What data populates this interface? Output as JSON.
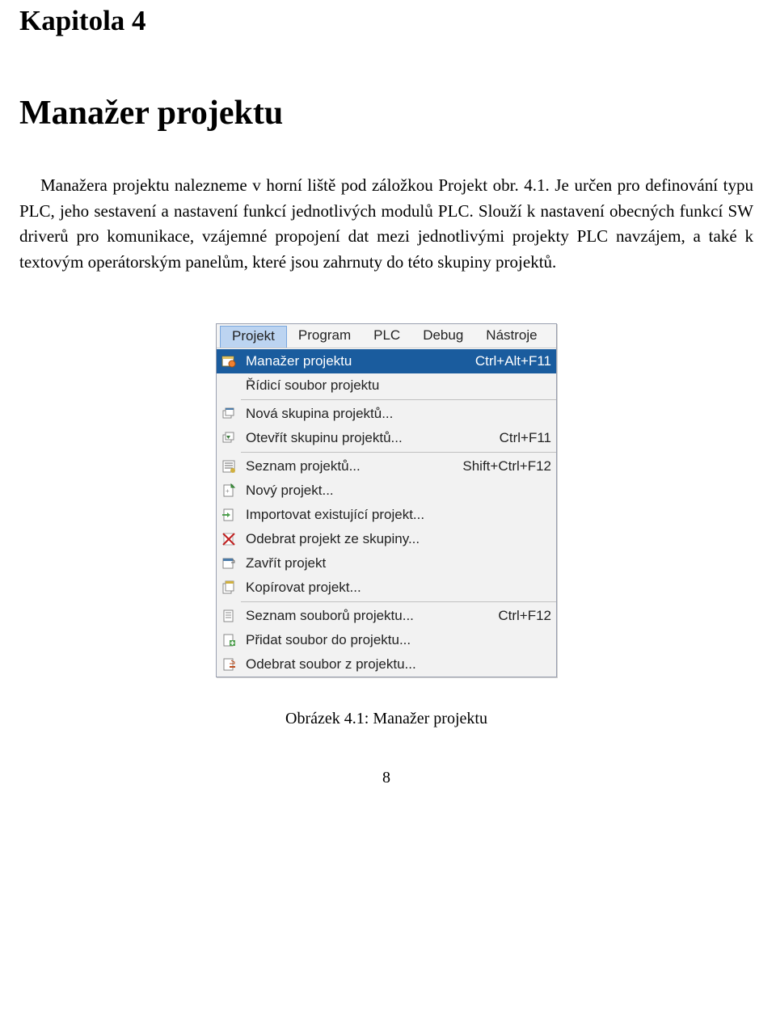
{
  "chapter_label": "Kapitola 4",
  "chapter_title": "Manažer projektu",
  "paragraph": "Manažera projektu nalezneme v horní liště pod záložkou Projekt obr. 4.1. Je určen pro definování typu PLC, jeho sestavení a nastavení funkcí jednotlivých modulů PLC. Slouží k nastavení obecných funkcí SW driverů pro komunikace, vzájemné propojení dat mezi jednotlivými projekty PLC navzájem, a také k textovým operátorským panelům, které jsou zahrnuty do této skupiny projektů.",
  "menubar": {
    "items": [
      "Projekt",
      "Program",
      "PLC",
      "Debug",
      "Nástroje"
    ],
    "open_index": 0
  },
  "menu": {
    "groups": [
      [
        {
          "label": "Manažer projektu",
          "shortcut": "Ctrl+Alt+F11",
          "highlight": true,
          "icon": "manager-icon"
        },
        {
          "label": "Řídicí soubor projektu",
          "shortcut": "",
          "highlight": false,
          "icon": ""
        }
      ],
      [
        {
          "label": "Nová skupina projektů...",
          "shortcut": "",
          "highlight": false,
          "icon": "new-group-icon"
        },
        {
          "label": "Otevřít skupinu projektů...",
          "shortcut": "Ctrl+F11",
          "highlight": false,
          "icon": "open-group-icon"
        }
      ],
      [
        {
          "label": "Seznam projektů...",
          "shortcut": "Shift+Ctrl+F12",
          "highlight": false,
          "icon": "list-icon"
        },
        {
          "label": "Nový projekt...",
          "shortcut": "",
          "highlight": false,
          "icon": "new-project-icon"
        },
        {
          "label": "Importovat existující projekt...",
          "shortcut": "",
          "highlight": false,
          "icon": "import-icon"
        },
        {
          "label": "Odebrat projekt ze skupiny...",
          "shortcut": "",
          "highlight": false,
          "icon": "remove-project-icon"
        },
        {
          "label": "Zavřít projekt",
          "shortcut": "",
          "highlight": false,
          "icon": "close-project-icon"
        },
        {
          "label": "Kopírovat projekt...",
          "shortcut": "",
          "highlight": false,
          "icon": "copy-project-icon"
        }
      ],
      [
        {
          "label": "Seznam souborů projektu...",
          "shortcut": "Ctrl+F12",
          "highlight": false,
          "icon": "file-list-icon"
        },
        {
          "label": "Přidat soubor do projektu...",
          "shortcut": "",
          "highlight": false,
          "icon": "add-file-icon"
        },
        {
          "label": "Odebrat soubor z projektu...",
          "shortcut": "",
          "highlight": false,
          "icon": "remove-file-icon"
        }
      ]
    ]
  },
  "caption": "Obrázek 4.1: Manažer projektu",
  "page_number": "8"
}
